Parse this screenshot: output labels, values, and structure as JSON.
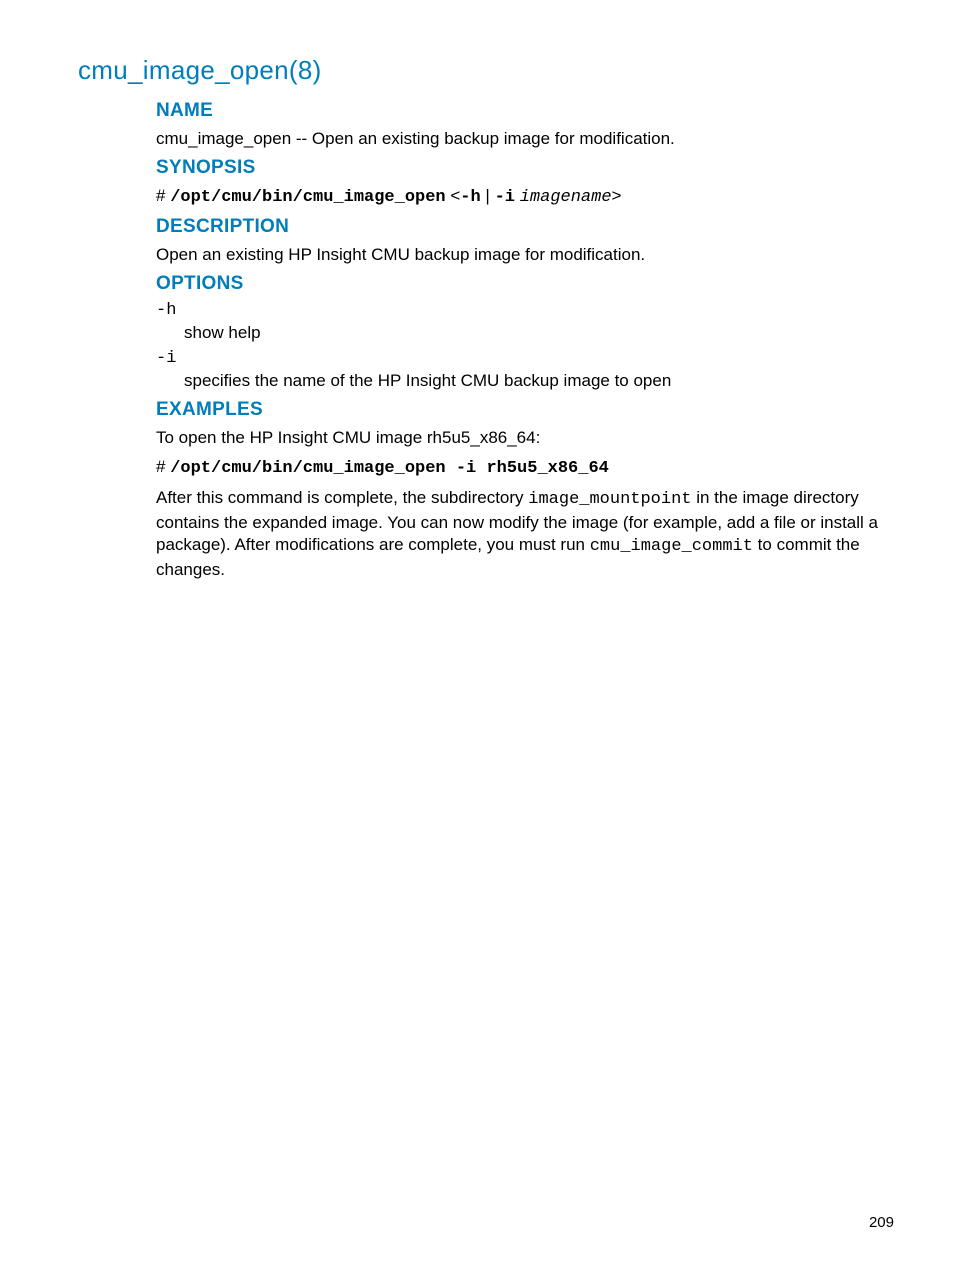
{
  "page": {
    "title": "cmu_image_open(8)",
    "sections": {
      "name": {
        "heading": "NAME",
        "text": "cmu_image_open -- Open an existing backup image for modification."
      },
      "synopsis": {
        "heading": "SYNOPSIS",
        "prompt": "# ",
        "cmd": "/opt/cmu/bin/cmu_image_open",
        "lt": " <",
        "flag_h": "-h",
        "pipe": " | ",
        "flag_i": "-i",
        "space": " ",
        "arg": "imagename",
        "gt": ">"
      },
      "description": {
        "heading": "DESCRIPTION",
        "text": "Open an existing HP Insight CMU backup image for modification."
      },
      "options": {
        "heading": "OPTIONS",
        "items": [
          {
            "flag": "-h",
            "desc": "show help"
          },
          {
            "flag": "-i",
            "desc": "specifies the name of the HP Insight CMU backup image to open"
          }
        ]
      },
      "examples": {
        "heading": "EXAMPLES",
        "intro": "To open the HP Insight CMU image rh5u5_x86_64:",
        "prompt": "# ",
        "cmd": "/opt/cmu/bin/cmu_image_open -i rh5u5_x86_64",
        "para_pre": "After this command is complete, the subdirectory ",
        "para_code1": "image_mountpoint",
        "para_mid": " in the image directory contains the expanded image. You can now modify the image (for example, add a file or install a package). After modifications are complete, you must run ",
        "para_code2": "cmu_image_commit",
        "para_post": " to commit the changes."
      }
    },
    "page_number": "209"
  }
}
